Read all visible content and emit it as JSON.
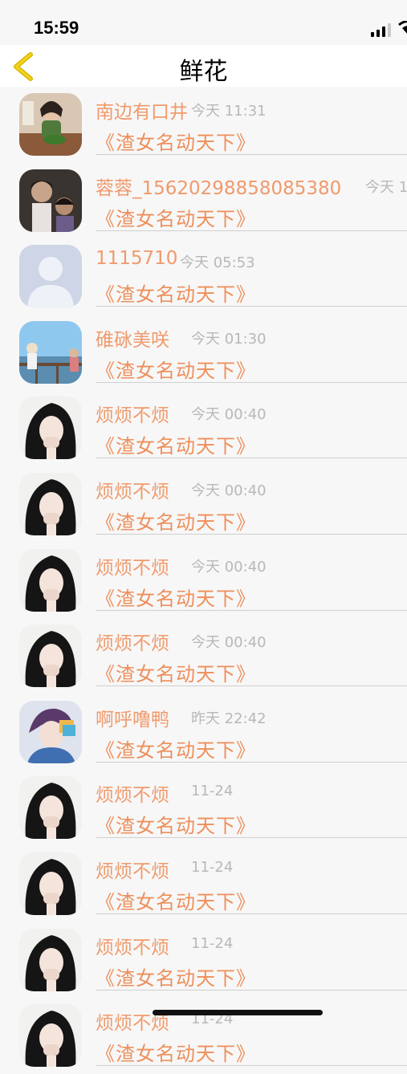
{
  "status": {
    "time": "15:59"
  },
  "nav": {
    "title": "鲜花"
  },
  "colors": {
    "name": "#f09a6c",
    "gift": "#ee8f5b",
    "time": "#b8b8b8",
    "background": "#f7f7f7"
  },
  "items": [
    {
      "name": "南边有口井",
      "time": "今天 11:31",
      "gift": "《渣女名动天下》",
      "avatar": "photo-girl-green-top"
    },
    {
      "name": "蓉蓉_15620298858085380",
      "time": "今天 1",
      "gift": "《渣女名动天下》",
      "avatar": "photo-two-children"
    },
    {
      "name": "1115710",
      "time": "今天 05:53",
      "gift": "《渣女名动天下》",
      "avatar": "default-user-silhouette"
    },
    {
      "name": "碓砯美咲",
      "time": "今天 01:30",
      "gift": "《渣女名动天下》",
      "avatar": "anime-scene-sky"
    },
    {
      "name": "烦烦不烦",
      "time": "今天 00:40",
      "gift": "《渣女名动天下》",
      "avatar": "illustration-girl-black-hair"
    },
    {
      "name": "烦烦不烦",
      "time": "今天 00:40",
      "gift": "《渣女名动天下》",
      "avatar": "illustration-girl-black-hair"
    },
    {
      "name": "烦烦不烦",
      "time": "今天 00:40",
      "gift": "《渣女名动天下》",
      "avatar": "illustration-girl-black-hair"
    },
    {
      "name": "烦烦不烦",
      "time": "今天 00:40",
      "gift": "《渣女名动天下》",
      "avatar": "illustration-girl-black-hair"
    },
    {
      "name": "啊呼噜鸭",
      "time": "昨天 22:42",
      "gift": "《渣女名动天下》",
      "avatar": "anime-boy-colorful"
    },
    {
      "name": "烦烦不烦",
      "time": "11-24",
      "gift": "《渣女名动天下》",
      "avatar": "illustration-girl-black-hair"
    },
    {
      "name": "烦烦不烦",
      "time": "11-24",
      "gift": "《渣女名动天下》",
      "avatar": "illustration-girl-black-hair"
    },
    {
      "name": "烦烦不烦",
      "time": "11-24",
      "gift": "《渣女名动天下》",
      "avatar": "illustration-girl-black-hair"
    },
    {
      "name": "烦烦不烦",
      "time": "11-24",
      "gift": "《渣女名动天下》",
      "avatar": "illustration-girl-black-hair"
    }
  ]
}
